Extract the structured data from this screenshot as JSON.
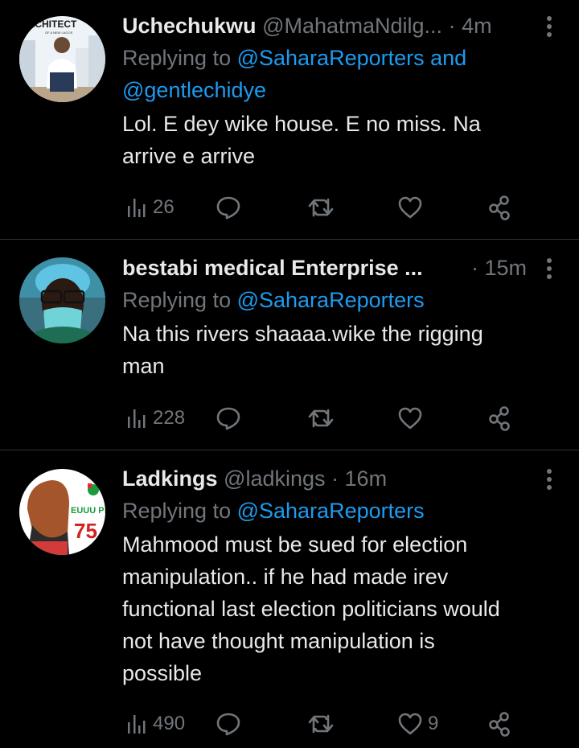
{
  "tweets": [
    {
      "name": "Uchechukwu",
      "handle": "@MahatmaNdilg...",
      "time": "· 4m",
      "replying_prefix": "Replying to ",
      "replying_line1": "@SaharaReporters and",
      "replying_line2": "@gentlechidye",
      "text_line1": "Lol. E dey wike house. E no miss. Na",
      "text_line2": "arrive e arrive",
      "avatar_text": "ARCHITECT",
      "avatar_subtext": "OF A NEW LAGOS",
      "views": "26",
      "likes": ""
    },
    {
      "name": "bestabi medical Enterprise ...",
      "handle": "",
      "time": "· 15m",
      "replying_prefix": "Replying to ",
      "replying_line1": "@SaharaReporters",
      "text_line1": "Na this rivers shaaaa.wike the rigging",
      "text_line2": "man",
      "views": "228",
      "likes": ""
    },
    {
      "name": "Ladkings",
      "handle": "@ladkings",
      "time": "· 16m",
      "replying_prefix": "Replying to ",
      "replying_line1": "@SaharaReporters",
      "text_line1": "Mahmood must be sued for election",
      "text_line2": "manipulation..  if he had made irev",
      "text_line3": "functional last election politicians would",
      "text_line4": "not have thought manipulation is",
      "text_line5": "possible",
      "avatar_text": "EUUU P!",
      "avatar_number": "75",
      "views": "490",
      "likes": "9"
    }
  ],
  "colors": {
    "background": "#000000",
    "text": "#e7e9ea",
    "muted": "#71767b",
    "link": "#1d9bf0",
    "divider": "#2f3336"
  }
}
